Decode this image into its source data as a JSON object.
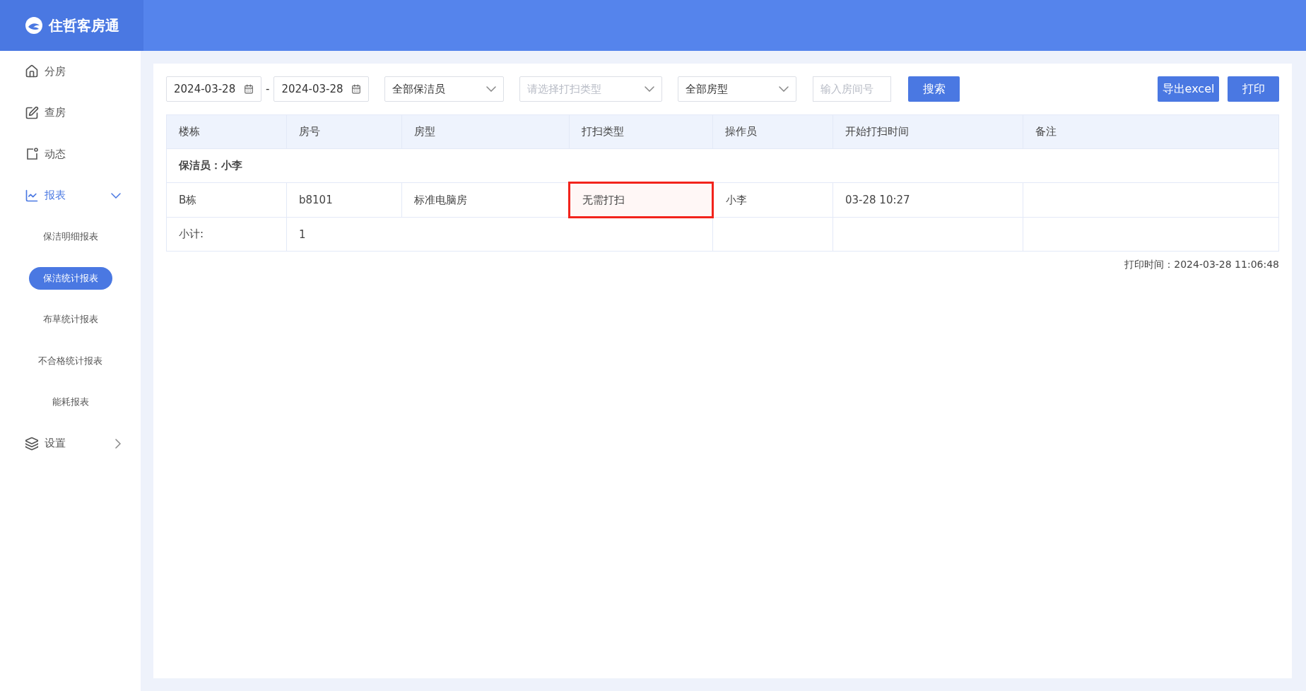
{
  "app": {
    "title": "住哲客房通"
  },
  "sidebar": {
    "items": [
      {
        "label": "分房",
        "selected": false
      },
      {
        "label": "查房",
        "selected": false
      },
      {
        "label": "动态",
        "selected": false
      },
      {
        "label": "报表",
        "selected": true,
        "expanded": true,
        "children": [
          {
            "label": "保洁明细报表",
            "selected": false
          },
          {
            "label": "保洁统计报表",
            "selected": true
          },
          {
            "label": "布草统计报表",
            "selected": false
          },
          {
            "label": "不合格统计报表",
            "selected": false
          },
          {
            "label": "能耗报表",
            "selected": false
          }
        ]
      },
      {
        "label": "设置",
        "selected": false,
        "expanded": false
      }
    ]
  },
  "filters": {
    "date_from": "2024-03-28",
    "separator": "-",
    "date_to": "2024-03-28",
    "cleaner_select": {
      "value": "全部保洁员"
    },
    "clean_type_select": {
      "placeholder": "请选择打扫类型"
    },
    "room_type_select": {
      "value": "全部房型"
    },
    "room_number": {
      "placeholder": "输入房间号"
    },
    "search_button": "搜索",
    "export_button": "导出excel",
    "print_button": "打印"
  },
  "table": {
    "columns": [
      "楼栋",
      "房号",
      "房型",
      "打扫类型",
      "操作员",
      "开始打扫时间",
      "备注"
    ],
    "groups": [
      {
        "label": "保洁员：小李",
        "rows": [
          {
            "cells": [
              {
                "text": "B栋",
                "highlighted": false
              },
              {
                "text": "b8101",
                "highlighted": false
              },
              {
                "text": "标准电脑房",
                "highlighted": false
              },
              {
                "text": "无需打扫",
                "highlighted": true
              },
              {
                "text": "小李",
                "highlighted": false
              },
              {
                "text": "03-28 10:27",
                "highlighted": false
              },
              {
                "text": "",
                "highlighted": false
              }
            ]
          }
        ],
        "subtotal": {
          "label": "小计:",
          "value": "1"
        }
      }
    ]
  },
  "print_time": "打印时间：2024-03-28 11:06:48"
}
